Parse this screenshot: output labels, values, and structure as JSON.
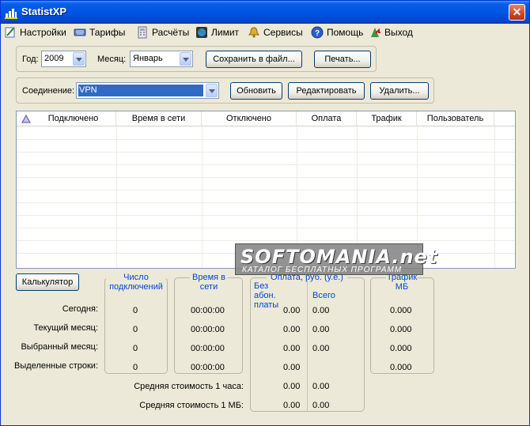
{
  "window": {
    "title": "StatistXP"
  },
  "menu": [
    {
      "label": "Настройки",
      "icon": "settings-icon"
    },
    {
      "label": "Тарифы",
      "icon": "keyboard-icon"
    },
    {
      "label": "Расчёты",
      "icon": "calculator-icon"
    },
    {
      "label": "Лимит",
      "icon": "globe-icon"
    },
    {
      "label": "Сервисы",
      "icon": "bell-icon"
    },
    {
      "label": "Помощь",
      "icon": "help-icon"
    },
    {
      "label": "Выход",
      "icon": "exit-icon"
    }
  ],
  "filters": {
    "year_label": "Год:",
    "year_value": "2009",
    "month_label": "Месяц:",
    "month_value": "Январь",
    "save_button": "Сохранить в файл...",
    "print_button": "Печать..."
  },
  "connection": {
    "label": "Соединение:",
    "value": "VPN",
    "refresh_button": "Обновить",
    "edit_button": "Редактировать",
    "delete_button": "Удалить..."
  },
  "table": {
    "columns": [
      "Подключено",
      "Время в сети",
      "Отключено",
      "Оплата",
      "Трафик",
      "Пользователь"
    ]
  },
  "summary": {
    "calculator_button": "Калькулятор",
    "group_connections": "Число подключений",
    "group_time": "Время в сети",
    "group_payment": "Оплата, руб. (у.е.)",
    "payment_sub1": "Без абон. платы",
    "payment_sub2": "Всего",
    "group_traffic": "Трафик МБ",
    "rows": [
      {
        "label": "Сегодня:",
        "connections": "0",
        "time": "00:00:00",
        "pay_no_sub": "0.00",
        "pay_total": "0.00",
        "traffic": "0.000"
      },
      {
        "label": "Текущий месяц:",
        "connections": "0",
        "time": "00:00:00",
        "pay_no_sub": "0.00",
        "pay_total": "0.00",
        "traffic": "0.000"
      },
      {
        "label": "Выбранный месяц:",
        "connections": "0",
        "time": "00:00:00",
        "pay_no_sub": "0.00",
        "pay_total": "0.00",
        "traffic": "0.000"
      },
      {
        "label": "Выделенные строки:",
        "connections": "0",
        "time": "00:00:00",
        "pay_no_sub": "0.00",
        "pay_total": "",
        "traffic": "0.000"
      }
    ],
    "avg_hour_label": "Средняя стоимость 1 часа:",
    "avg_hour_no_sub": "0.00",
    "avg_hour_total": "0.00",
    "avg_mb_label": "Средняя стоимость 1 МБ:",
    "avg_mb_no_sub": "0.00",
    "avg_mb_total": "0.00"
  },
  "watermark": {
    "title": "SOFTOMANIA.net",
    "subtitle": "КАТАЛОГ БЕСПЛАТНЫХ ПРОГРАММ"
  }
}
